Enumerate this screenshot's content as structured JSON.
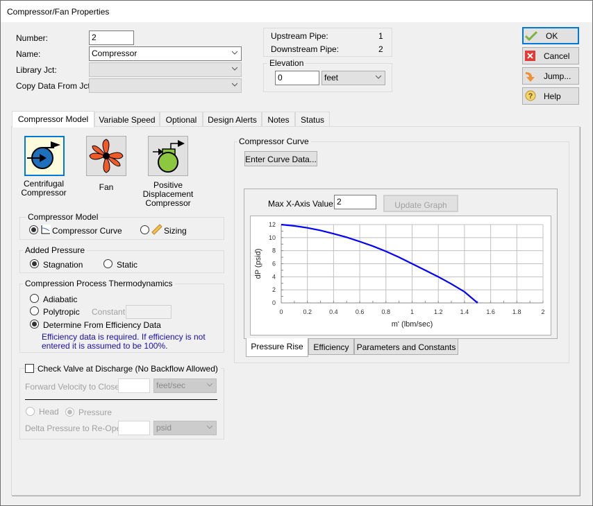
{
  "window": {
    "title": "Compressor/Fan Properties"
  },
  "header": {
    "number_label": "Number:",
    "number_value": "2",
    "name_label": "Name:",
    "name_value": "Compressor",
    "library_label": "Library Jct:",
    "library_value": "",
    "copy_label": "Copy Data From Jct...",
    "copy_value": ""
  },
  "pipes": {
    "upstream_label": "Upstream Pipe:",
    "upstream_value": "1",
    "downstream_label": "Downstream Pipe:",
    "downstream_value": "2"
  },
  "elevation": {
    "title": "Elevation",
    "value": "0",
    "unit": "feet"
  },
  "buttons": {
    "ok": "OK",
    "cancel": "Cancel",
    "jump": "Jump...",
    "help": "Help"
  },
  "tabs": [
    {
      "label": "Compressor Model",
      "active": true
    },
    {
      "label": "Variable Speed",
      "active": false
    },
    {
      "label": "Optional",
      "active": false
    },
    {
      "label": "Design Alerts",
      "active": false
    },
    {
      "label": "Notes",
      "active": false
    },
    {
      "label": "Status",
      "active": false
    }
  ],
  "types": [
    {
      "label_line1": "Centrifugal",
      "label_line2": "Compressor",
      "selected": true
    },
    {
      "label_line1": "Fan",
      "selected": false
    },
    {
      "label_line1": "Positive",
      "label_line2": "Displacement",
      "label_line3": "Compressor",
      "selected": false
    }
  ],
  "compressor_model": {
    "title": "Compressor Model",
    "options": [
      {
        "label": "Compressor Curve",
        "checked": true
      },
      {
        "label": "Sizing",
        "checked": false
      }
    ]
  },
  "added_pressure": {
    "title": "Added Pressure",
    "options": [
      {
        "label": "Stagnation",
        "checked": true
      },
      {
        "label": "Static",
        "checked": false
      }
    ]
  },
  "thermo": {
    "title": "Compression Process Thermodynamics",
    "options": [
      {
        "label": "Adiabatic",
        "checked": false
      },
      {
        "label": "Polytropic",
        "checked": false
      },
      {
        "label": "Determine From Efficiency Data",
        "checked": true
      }
    ],
    "constant_label": "Constant:",
    "constant_value": "",
    "note_line1": "Efficiency data is required. If efficiency is not",
    "note_line2": "entered it is assumed to be 100%.",
    "note_color": "#1a0dab"
  },
  "check_valve": {
    "label": "Check Valve at Discharge (No Backflow Allowed)",
    "checked": false,
    "forward_label": "Forward Velocity to Close",
    "forward_value": "",
    "forward_unit": "feet/sec",
    "head_label": "Head",
    "pressure_label": "Pressure",
    "pressure_checked": true,
    "delta_label": "Delta Pressure to Re-Open",
    "delta_value": "",
    "delta_unit": "psid"
  },
  "curve": {
    "title": "Compressor Curve",
    "enter_button": "Enter Curve Data...",
    "max_x_label": "Max X-Axis Value:",
    "max_x_value": "2",
    "update_button": "Update Graph",
    "subtabs": [
      {
        "label": "Pressure Rise",
        "active": true
      },
      {
        "label": "Efficiency",
        "active": false
      },
      {
        "label": "Parameters and Constants",
        "active": false
      }
    ]
  },
  "chart_data": {
    "type": "line",
    "title": "",
    "xlabel": "m'  (lbm/sec)",
    "ylabel": "dP (psid)",
    "xlim": [
      0,
      2
    ],
    "ylim": [
      0,
      12
    ],
    "xticks": [
      "0",
      "0.2",
      "0.4",
      "0.6",
      "0.8",
      "1",
      "1.2",
      "1.4",
      "1.6",
      "1.8",
      "2"
    ],
    "yticks": [
      "0",
      "2",
      "4",
      "6",
      "8",
      "10",
      "12"
    ],
    "grid": true,
    "series": [
      {
        "name": "Pressure Rise",
        "color": "#0000ff",
        "x": [
          0,
          0.1,
          0.2,
          0.3,
          0.4,
          0.5,
          0.6,
          0.7,
          0.8,
          0.9,
          1.0,
          1.1,
          1.2,
          1.3,
          1.4,
          1.5
        ],
        "y": [
          12,
          11.8,
          11.5,
          11.1,
          10.6,
          10.05,
          9.4,
          8.7,
          7.9,
          7.0,
          6.0,
          5.0,
          4.0,
          2.9,
          1.7,
          0
        ]
      }
    ]
  }
}
